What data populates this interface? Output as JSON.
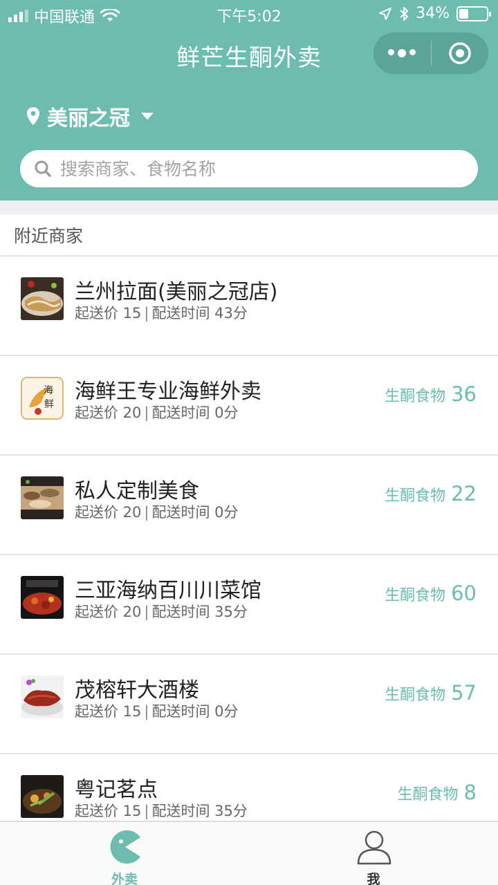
{
  "status_bar": {
    "carrier": "中国联通",
    "time": "下午5:02",
    "battery": "34%",
    "battery_level": 0.34
  },
  "nav": {
    "title": "鲜芒生酮外卖",
    "more_icon": "more-dots-icon",
    "close_icon": "target-circle-icon"
  },
  "location": {
    "name": "美丽之冠",
    "icon": "location-pin-icon"
  },
  "search": {
    "placeholder": "搜索商家、食物名称",
    "icon": "search-icon"
  },
  "section": {
    "title": "附近商家"
  },
  "stores": [
    {
      "name": "兰州拉面(美丽之冠店)",
      "min_label": "起送价 15",
      "time_label": "配送时间 43分",
      "keto_label": "",
      "keto_count": ""
    },
    {
      "name": "海鲜王专业海鲜外卖",
      "min_label": "起送价 20",
      "time_label": "配送时间 0分",
      "keto_label": "生酮食物",
      "keto_count": "36"
    },
    {
      "name": "私人定制美食",
      "min_label": "起送价 20",
      "time_label": "配送时间 0分",
      "keto_label": "生酮食物",
      "keto_count": "22"
    },
    {
      "name": "三亚海纳百川川菜馆",
      "min_label": "起送价 20",
      "time_label": "配送时间 35分",
      "keto_label": "生酮食物",
      "keto_count": "60"
    },
    {
      "name": "茂榕轩大酒楼",
      "min_label": "起送价 15",
      "time_label": "配送时间 0分",
      "keto_label": "生酮食物",
      "keto_count": "57"
    },
    {
      "name": "粤记茗点",
      "min_label": "起送价 15",
      "time_label": "配送时间 35分",
      "keto_label": "生酮食物",
      "keto_count": "8"
    }
  ],
  "tabbar": {
    "tabs": [
      {
        "label": "外卖",
        "icon": "pacman-icon",
        "active": true
      },
      {
        "label": "我",
        "icon": "user-icon",
        "active": false
      }
    ]
  },
  "colors": {
    "accent": "#6cbcb0",
    "text_primary": "#222222",
    "text_secondary": "#666666",
    "divider": "#e6e6e6"
  }
}
